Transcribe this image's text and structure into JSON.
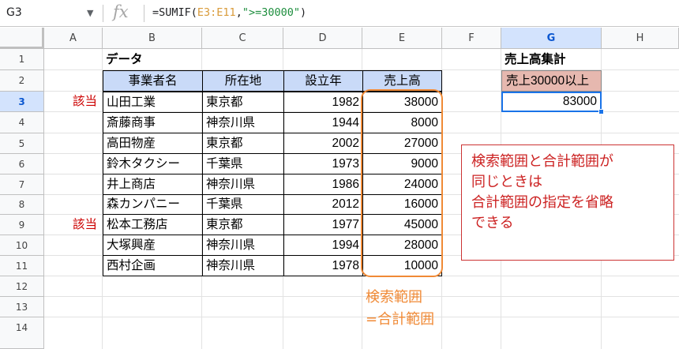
{
  "formula_bar": {
    "cell_ref": "G3",
    "caret": "▼",
    "fx": "fx",
    "formula_prefix": "=SUMIF(",
    "formula_range": "E3:E11",
    "formula_mid": ",",
    "formula_string": "\">=30000\"",
    "formula_suffix": ")"
  },
  "columns": [
    "A",
    "B",
    "C",
    "D",
    "E",
    "F",
    "G",
    "H"
  ],
  "rows": [
    "1",
    "2",
    "3",
    "4",
    "5",
    "6",
    "7",
    "8",
    "9",
    "10",
    "11",
    "12",
    "13",
    "14"
  ],
  "selected_cell": {
    "column": "G",
    "row": "3"
  },
  "sheet": {
    "title": "データ",
    "headers": [
      "事業者名",
      "所在地",
      "設立年",
      "売上高"
    ],
    "records": [
      {
        "name": "山田工業",
        "location": "東京都",
        "year": "1982",
        "sales": "38000",
        "mark": "該当"
      },
      {
        "name": "斎藤商事",
        "location": "神奈川県",
        "year": "1944",
        "sales": "8000",
        "mark": ""
      },
      {
        "name": "高田物産",
        "location": "東京都",
        "year": "2002",
        "sales": "27000",
        "mark": ""
      },
      {
        "name": "鈴木タクシー",
        "location": "千葉県",
        "year": "1973",
        "sales": "9000",
        "mark": ""
      },
      {
        "name": "井上商店",
        "location": "神奈川県",
        "year": "1986",
        "sales": "24000",
        "mark": ""
      },
      {
        "name": "森カンパニー",
        "location": "千葉県",
        "year": "2012",
        "sales": "16000",
        "mark": ""
      },
      {
        "name": "松本工務店",
        "location": "東京都",
        "year": "1977",
        "sales": "45000",
        "mark": "該当"
      },
      {
        "name": "大塚興産",
        "location": "神奈川県",
        "year": "1994",
        "sales": "28000",
        "mark": ""
      },
      {
        "name": "西村企画",
        "location": "神奈川県",
        "year": "1978",
        "sales": "10000",
        "mark": ""
      }
    ]
  },
  "summary": {
    "title": "売上高集計",
    "label": "売上30000以上",
    "value": "83000"
  },
  "callout": {
    "lines": [
      "検索範囲と合計範囲が",
      "同じときは",
      "合計範囲の指定を省略",
      "できる"
    ]
  },
  "range_note": {
    "lines": [
      "検索範囲",
      "=合計範囲"
    ]
  },
  "colors": {
    "header_fill": "#c9daf8",
    "summary_label_fill": "#e6b8af",
    "highlight_orange": "#f08a36",
    "note_red": "#cc2222",
    "selection_blue": "#1a73e8"
  }
}
